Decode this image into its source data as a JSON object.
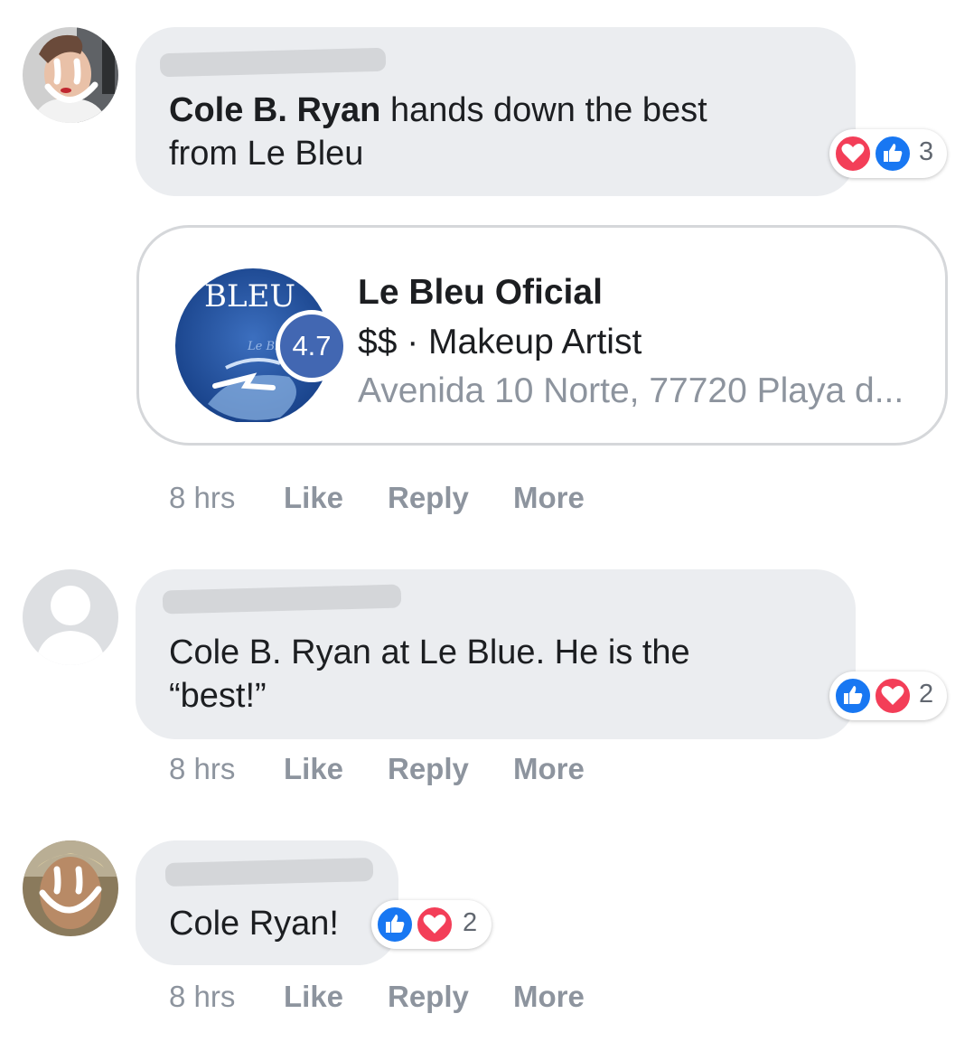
{
  "comments": [
    {
      "author_bold": "Cole B. Ryan",
      "text": " hands down the best",
      "text_line2": "from Le Bleu",
      "reactions": [
        "love-icon",
        "like-icon"
      ],
      "reaction_count": "3",
      "time": "8 hrs",
      "like_label": "Like",
      "reply_label": "Reply",
      "more_label": "More"
    },
    {
      "text": "Cole B. Ryan at Le Blue. He is the",
      "text_line2": "“best!”",
      "reactions": [
        "like-icon",
        "love-icon"
      ],
      "reaction_count": "2",
      "time": "8 hrs",
      "like_label": "Like",
      "reply_label": "Reply",
      "more_label": "More"
    },
    {
      "text": "Cole Ryan!",
      "reactions": [
        "like-icon",
        "love-icon"
      ],
      "reaction_count": "2",
      "time": "8 hrs",
      "like_label": "Like",
      "reply_label": "Reply",
      "more_label": "More"
    }
  ],
  "place_card": {
    "logo_text": "BLEU",
    "logo_script": "Le Bleu",
    "rating": "4.7",
    "name": "Le Bleu Oficial",
    "meta": "$$ · Makeup Artist",
    "address": "Avenida 10 Norte, 77720 Playa d..."
  },
  "colors": {
    "bubble_bg": "#ebedf0",
    "like_blue": "#1877f2",
    "love_red": "#f33e58",
    "rating_badge": "#4267b2",
    "meta_gray": "#8d949e"
  }
}
